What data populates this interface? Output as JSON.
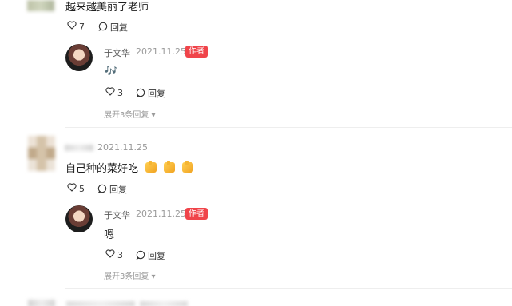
{
  "thread_top": {
    "reply_text": "越来越美丽了老师",
    "likes": "7",
    "reply_label": "回复",
    "author_reply": {
      "author_name": "于文华",
      "date": "2021.11.25",
      "badge": "作者",
      "text": "🎶",
      "likes": "3",
      "reply_label": "回复",
      "expand_label": "展开3条回复 ▾"
    }
  },
  "comment_second": {
    "date": "2021.11.25",
    "text": "自己种的菜好吃",
    "likes": "5",
    "reply_label": "回复",
    "author_reply": {
      "author_name": "于文华",
      "date": "2021.11.25",
      "badge": "作者",
      "text": "嗯",
      "likes": "3",
      "reply_label": "回复",
      "expand_label": "展开3条回复 ▾"
    }
  },
  "icons": {
    "like": "heart-icon",
    "reply": "comment-bubble-icon",
    "music": "music-note-icon",
    "thumb": "thumbs-up-icon"
  },
  "colors": {
    "badge_bg": "#f0444a",
    "meta_text": "#9a9a9a",
    "main_text": "#1f1f1f"
  }
}
